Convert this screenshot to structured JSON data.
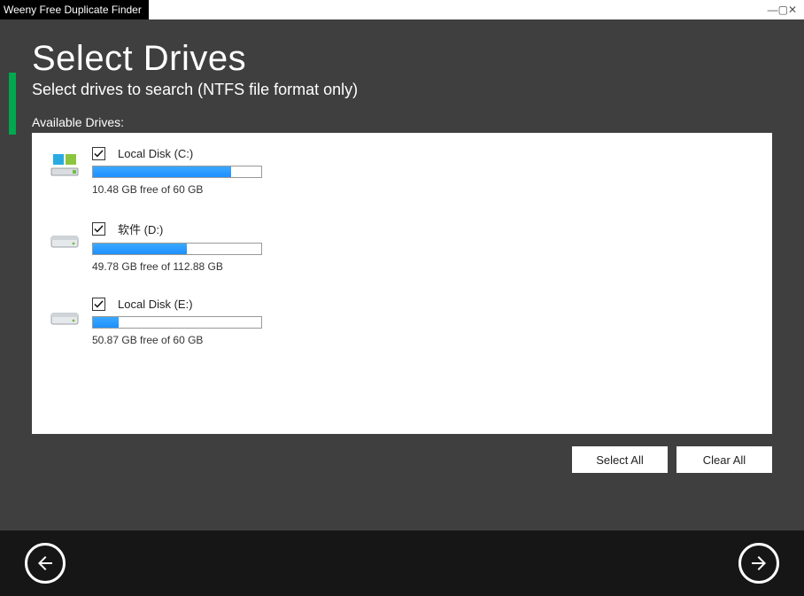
{
  "titlebar": {
    "title": "Weeny Free Duplicate Finder"
  },
  "header": {
    "title": "Select Drives",
    "subtitle": "Select drives to search (NTFS file format only)",
    "available_label": "Available Drives:"
  },
  "drives": [
    {
      "name": "Local Disk (C:)",
      "free_text": "10.48 GB free of 60 GB",
      "checked": true,
      "used_percent": 82,
      "icon": "os"
    },
    {
      "name": "软件 (D:)",
      "free_text": "49.78 GB free of 112.88 GB",
      "checked": true,
      "used_percent": 56,
      "icon": "hdd"
    },
    {
      "name": "Local Disk (E:)",
      "free_text": "50.87 GB free of 60 GB",
      "checked": true,
      "used_percent": 15,
      "icon": "hdd"
    }
  ],
  "buttons": {
    "select_all": "Select All",
    "clear_all": "Clear All"
  }
}
